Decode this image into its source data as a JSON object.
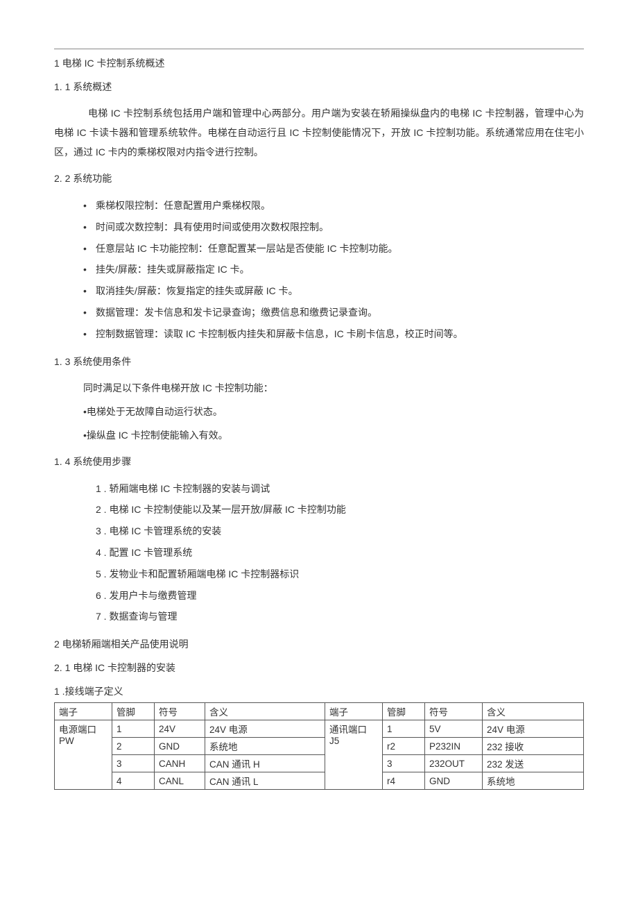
{
  "h1_1": "1 电梯 IC 卡控制系统概述",
  "h2_11": "1.  1 系统概述",
  "p_intro": "电梯 IC 卡控制系统包括用户端和管理中心两部分。用户端为安装在轿厢操纵盘内的电梯 IC 卡控制器，管理中心为电梯 IC 卡读卡器和管理系统软件。电梯在自动运行且 IC 卡控制使能情况下，开放 IC 卡控制功能。系统通常应用在住宅小区，通过 IC 卡内的乘梯权限对内指令进行控制。",
  "h2_22": "2.  2 系统功能",
  "features": [
    "乘梯权限控制：任意配置用户乘梯权限。",
    "时间或次数控制：具有使用时间或使用次数权限控制。",
    "任意层站 IC 卡功能控制：任意配置某一层站是否使能 IC 卡控制功能。",
    "挂失/屏蔽：挂失或屏蔽指定 IC 卡。",
    "取消挂失/屏蔽：恢复指定的挂失或屏蔽 IC 卡。",
    "数据管理：发卡信息和发卡记录查询；缴费信息和缴费记录查询。",
    "控制数据管理：读取 IC 卡控制板内挂失和屏蔽卡信息，IC 卡刷卡信息，校正时间等。"
  ],
  "h2_13": "1.  3 系统使用条件",
  "cond_intro": "同时满足以下条件电梯开放 IC 卡控制功能：",
  "cond_1": "•电梯处于无故障自动运行状态。",
  "cond_2": "•操纵盘 IC 卡控制使能输入有效。",
  "h2_14": "1.  4 系统使用步骤",
  "steps": [
    "1 . 轿厢端电梯 IC 卡控制器的安装与调试",
    "2 . 电梯 IC 卡控制使能以及某一层开放/屏蔽 IC 卡控制功能",
    "3 . 电梯 IC 卡管理系统的安装",
    "4 . 配置 IC 卡管理系统",
    "5 . 发物业卡和配置轿厢端电梯 IC 卡控制器标识",
    "6 . 发用户卡与缴费管理",
    "7 . 数据查询与管理"
  ],
  "h1_2": "2 电梯轿厢端相关产品使用说明",
  "h2_21": "2.  1 电梯 IC 卡控制器的安装",
  "h3_term": "1 .接线端子定义",
  "table": {
    "headers": [
      "端子",
      "管脚",
      "符号",
      "含义",
      "端子",
      "管脚",
      "符号",
      "含义"
    ],
    "left_port": "电源端口 PW",
    "right_port": "通讯端口 J5",
    "rows": [
      {
        "l_pin": "1",
        "l_sym": "24V",
        "l_mean": "24V 电源",
        "r_pin": "1",
        "r_sym": "5V",
        "r_mean": "24V 电源"
      },
      {
        "l_pin": "2",
        "l_sym": "GND",
        "l_mean": "系统地",
        "r_pin": "r2",
        "r_sym": "P232IN",
        "r_mean": "232 接收"
      },
      {
        "l_pin": "3",
        "l_sym": "CANH",
        "l_mean": "CAN 通讯 H",
        "r_pin": "3",
        "r_sym": "232OUT",
        "r_mean": "232 发送"
      },
      {
        "l_pin": "4",
        "l_sym": "CANL",
        "l_mean": "CAN 通讯 L",
        "r_pin": "r4",
        "r_sym": "GND",
        "r_mean": "系统地"
      }
    ]
  }
}
